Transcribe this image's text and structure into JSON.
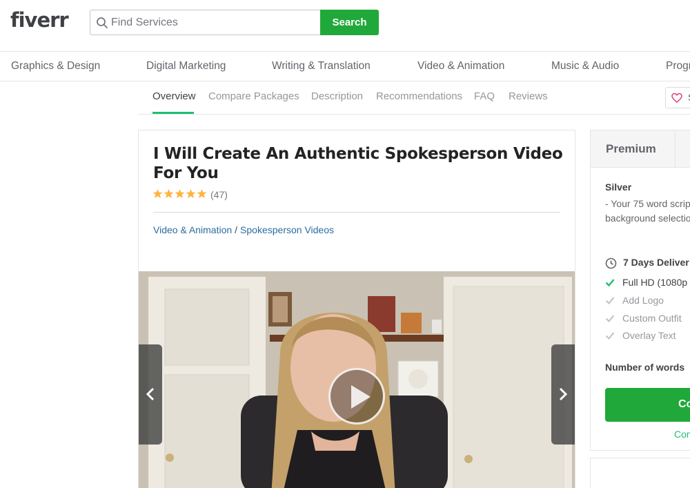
{
  "header": {
    "logo": "fiverr",
    "search_placeholder": "Find Services",
    "search_button": "Search"
  },
  "categories": [
    "Graphics & Design",
    "Digital Marketing",
    "Writing & Translation",
    "Video & Animation",
    "Music & Audio",
    "Progr"
  ],
  "tabs": [
    "Overview",
    "Compare Packages",
    "Description",
    "Recommendations",
    "FAQ",
    "Reviews"
  ],
  "save_label": "S",
  "gig": {
    "title": "I Will Create An Authentic Spokesperson Video For You",
    "rating": 5,
    "review_count": "(47)",
    "breadcrumb": [
      "Video & Animation",
      "Spokesperson Videos"
    ],
    "breadcrumb_sep": "/"
  },
  "package": {
    "tab_label": "Premium",
    "name": "Silver",
    "desc_line1": "- Your 75 word scrip",
    "desc_line2": "background selectio",
    "delivery": "7 Days Deliver",
    "features": [
      {
        "label": "Full HD (1080p",
        "included": true
      },
      {
        "label": "Add Logo",
        "included": false
      },
      {
        "label": "Custom Outfit",
        "included": false
      },
      {
        "label": "Overlay Text",
        "included": false
      }
    ],
    "words_label": "Number of words",
    "continue_label": "Co",
    "compare_label": "Com"
  },
  "colors": {
    "brand_green": "#21a83a",
    "link_blue": "#2b6c9f",
    "star_yellow": "#ffb33e"
  }
}
